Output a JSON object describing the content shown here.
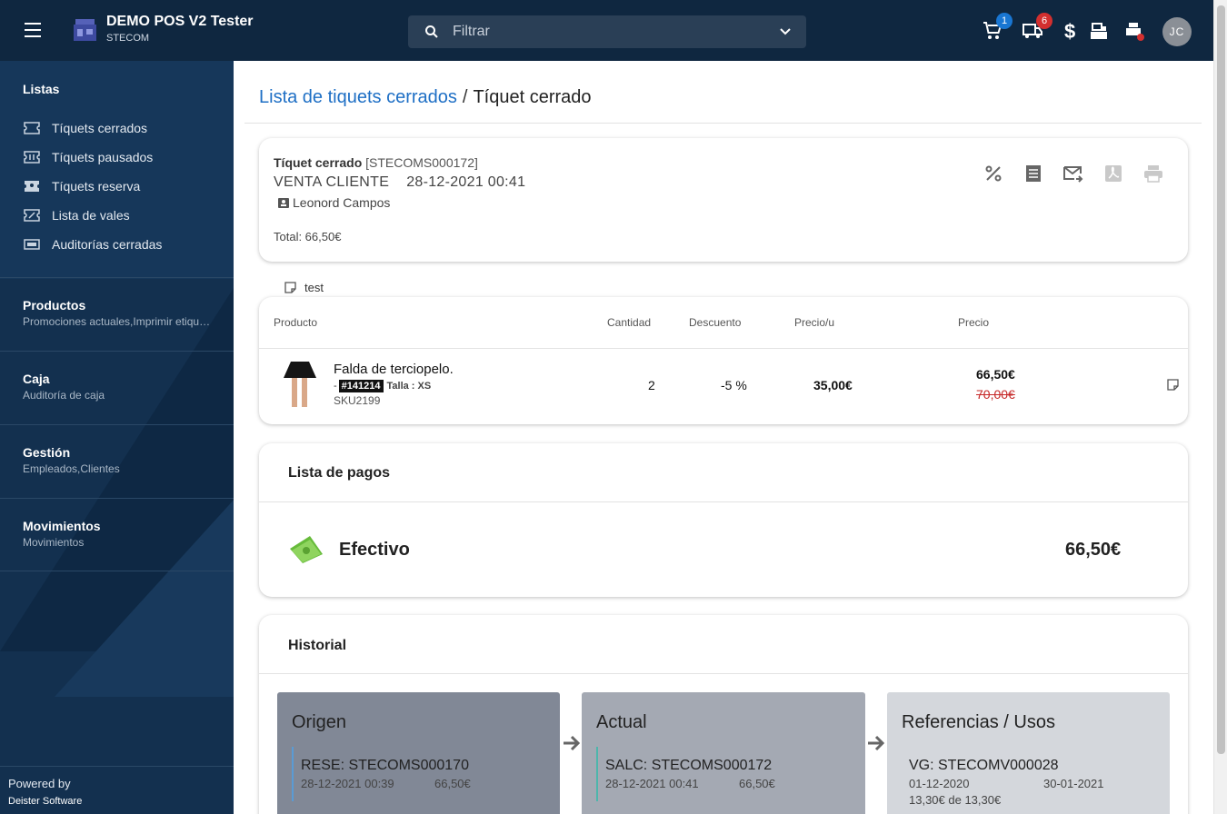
{
  "topbar": {
    "app_title": "DEMO POS V2 Tester",
    "app_subtitle": "STECOM",
    "search_placeholder": "Filtrar",
    "cart_badge": "1",
    "truck_badge": "6",
    "avatar_initials": "JC",
    "icons": [
      "menu-icon",
      "store-logo-icon",
      "search-icon",
      "chevron-down-icon",
      "cart-icon",
      "truck-icon",
      "dollar-icon",
      "cash-register-icon",
      "printer-alert-icon"
    ]
  },
  "sidebar": {
    "lists_title": "Listas",
    "items": [
      {
        "label": "Tíquets cerrados",
        "icon": "ticket-icon"
      },
      {
        "label": "Tíquets pausados",
        "icon": "ticket-paused-icon"
      },
      {
        "label": "Tíquets reserva",
        "icon": "ticket-reserve-icon"
      },
      {
        "label": "Lista de vales",
        "icon": "voucher-icon"
      },
      {
        "label": "Auditorías cerradas",
        "icon": "audit-icon"
      }
    ],
    "groups": [
      {
        "title": "Productos",
        "subtitle": "Promociones actuales,Imprimir etiquetas"
      },
      {
        "title": "Caja",
        "subtitle": "Auditoría de caja"
      },
      {
        "title": "Gestión",
        "subtitle": "Empleados,Clientes"
      },
      {
        "title": "Movimientos",
        "subtitle": "Movimientos"
      }
    ],
    "footer_powered": "Powered by",
    "footer_company": "Deister Software"
  },
  "breadcrumb": {
    "parent": "Lista de tiquets cerrados",
    "separator": "/",
    "current": "Tíquet cerrado"
  },
  "ticket": {
    "label": "Tíquet cerrado",
    "code": "[STECOMS000172]",
    "type": "VENTA CLIENTE",
    "datetime": "28-12-2021 00:41",
    "employee": "Leonord Campos",
    "total": "Total: 66,50€",
    "actions": [
      "percent-icon",
      "receipt-icon",
      "email-forward-icon",
      "pdf-icon",
      "print-icon"
    ]
  },
  "note": {
    "text": "test"
  },
  "lines": {
    "headers": {
      "product": "Producto",
      "qty": "Cantidad",
      "discount": "Descuento",
      "unit": "Precio/u",
      "price": "Precio"
    },
    "rows": [
      {
        "name": "Falda de terciopelo.",
        "prefix": "-",
        "tag": "#141214",
        "size": "Talla : XS",
        "sku": "SKU2199",
        "qty": "2",
        "discount": "-5 %",
        "unit_price": "35,00€",
        "price": "66,50€",
        "old_price": "70,00€"
      }
    ]
  },
  "payments": {
    "title": "Lista de pagos",
    "items": [
      {
        "method": "Efectivo",
        "amount": "66,50€"
      }
    ]
  },
  "history": {
    "title": "Historial",
    "boxes": [
      {
        "title": "Origen",
        "code": "RESE: STECOMS000170",
        "date": "28-12-2021 00:39",
        "amount": "66,50€",
        "color": "#818896",
        "line_color": "#5a9bd4"
      },
      {
        "title": "Actual",
        "code": "SALC: STECOMS000172",
        "date": "28-12-2021 00:41",
        "amount": "66,50€",
        "color": "#a4a9b3",
        "line_color": "#4db6ac"
      },
      {
        "title": "Referencias / Usos",
        "code": "VG: STECOMV000028",
        "date": "01-12-2020",
        "amount": "30-01-2021",
        "extra": "13,30€ de 13,30€",
        "color": "#d4d7dc"
      }
    ]
  }
}
